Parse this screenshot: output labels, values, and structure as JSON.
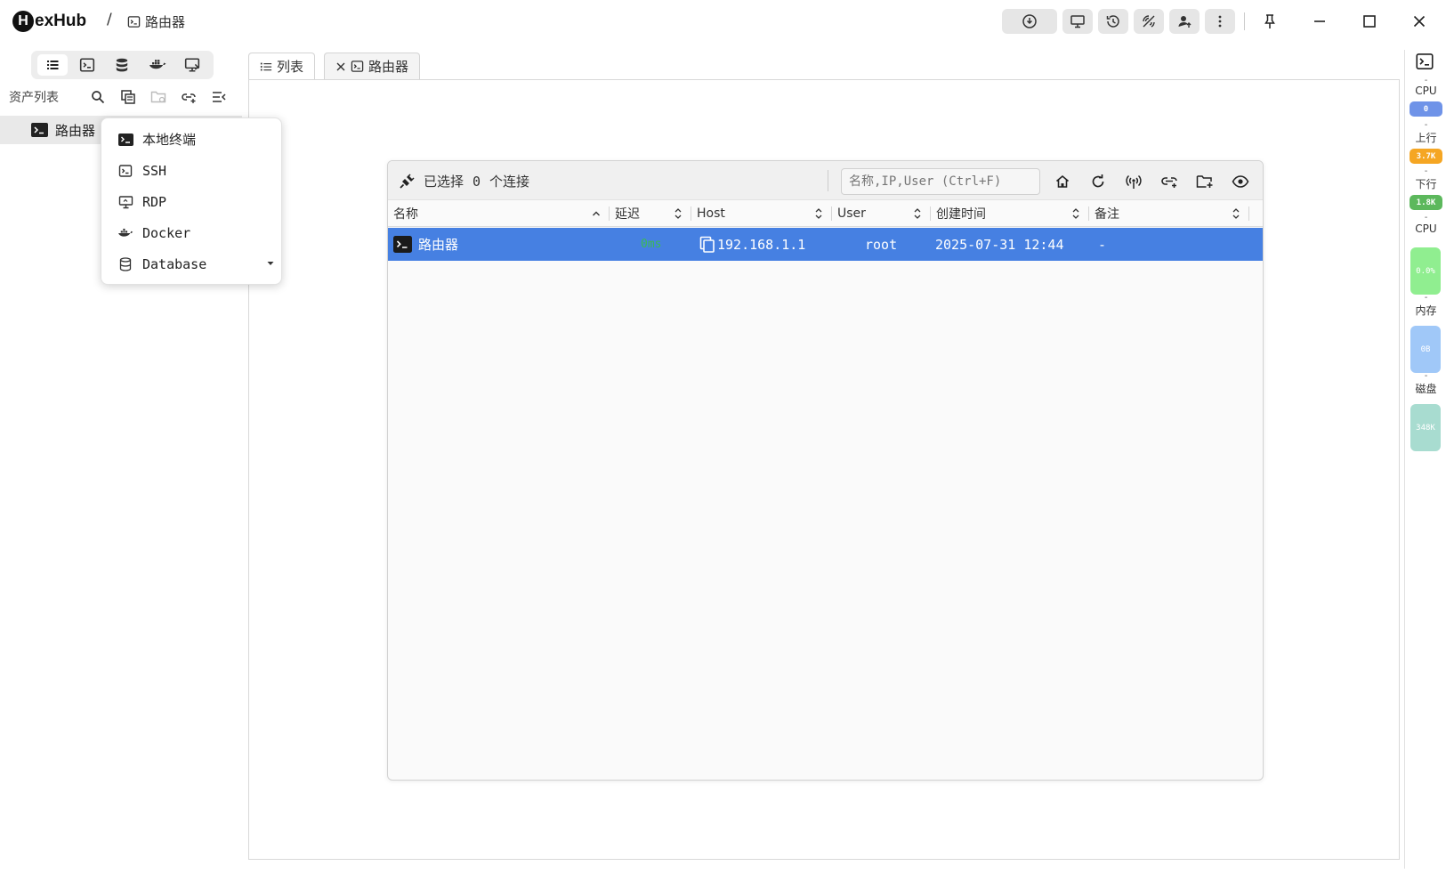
{
  "app": {
    "logo_letter": "H",
    "logo_rest": "exHub"
  },
  "breadcrumb": {
    "separator": "/",
    "current": "路由器"
  },
  "sidebar": {
    "asset_title": "资产列表",
    "tree": [
      {
        "label": "路由器"
      }
    ]
  },
  "menu": {
    "items": [
      {
        "label": "本地终端",
        "icon": "terminal-filled-icon"
      },
      {
        "label": "SSH",
        "icon": "terminal-icon"
      },
      {
        "label": "RDP",
        "icon": "monitor-icon"
      },
      {
        "label": "Docker",
        "icon": "docker-icon"
      },
      {
        "label": "Database",
        "icon": "database-icon",
        "has_submenu": true
      }
    ]
  },
  "tabs": [
    {
      "label": "列表",
      "icon": "list-icon"
    },
    {
      "label": "路由器",
      "icon": "terminal-icon",
      "closable": true
    }
  ],
  "conn_panel": {
    "selected_prefix": "已选择",
    "selected_count": "0",
    "selected_suffix": "个连接",
    "search_placeholder": "名称,IP,User (Ctrl+F)",
    "columns": [
      "名称",
      "延迟",
      "Host",
      "User",
      "创建时间",
      "备注"
    ],
    "rows": [
      {
        "name": "路由器",
        "latency": "0ms",
        "host": "192.168.1.1",
        "user": "root",
        "created": "2025-07-31 12:44",
        "note": "-"
      }
    ]
  },
  "metrics": {
    "cpu_label": "CPU",
    "cpu_value": "0",
    "up_label": "上行",
    "up_value": "3.7K",
    "down_label": "下行",
    "down_value": "1.8K",
    "cpu2_label": "CPU",
    "cpu2_value": "0.0%",
    "mem_label": "内存",
    "mem_value": "0B",
    "disk_label": "磁盘",
    "disk_value": "348K",
    "dash": "-"
  },
  "colors": {
    "accent": "#4680e2",
    "upload": "#f5a623",
    "download": "#5cb85c",
    "cpu_bar": "#90ee90",
    "mem_bar": "#a0c8f8",
    "disk_bar": "#a8dcd0",
    "latency": "#3cba54"
  }
}
